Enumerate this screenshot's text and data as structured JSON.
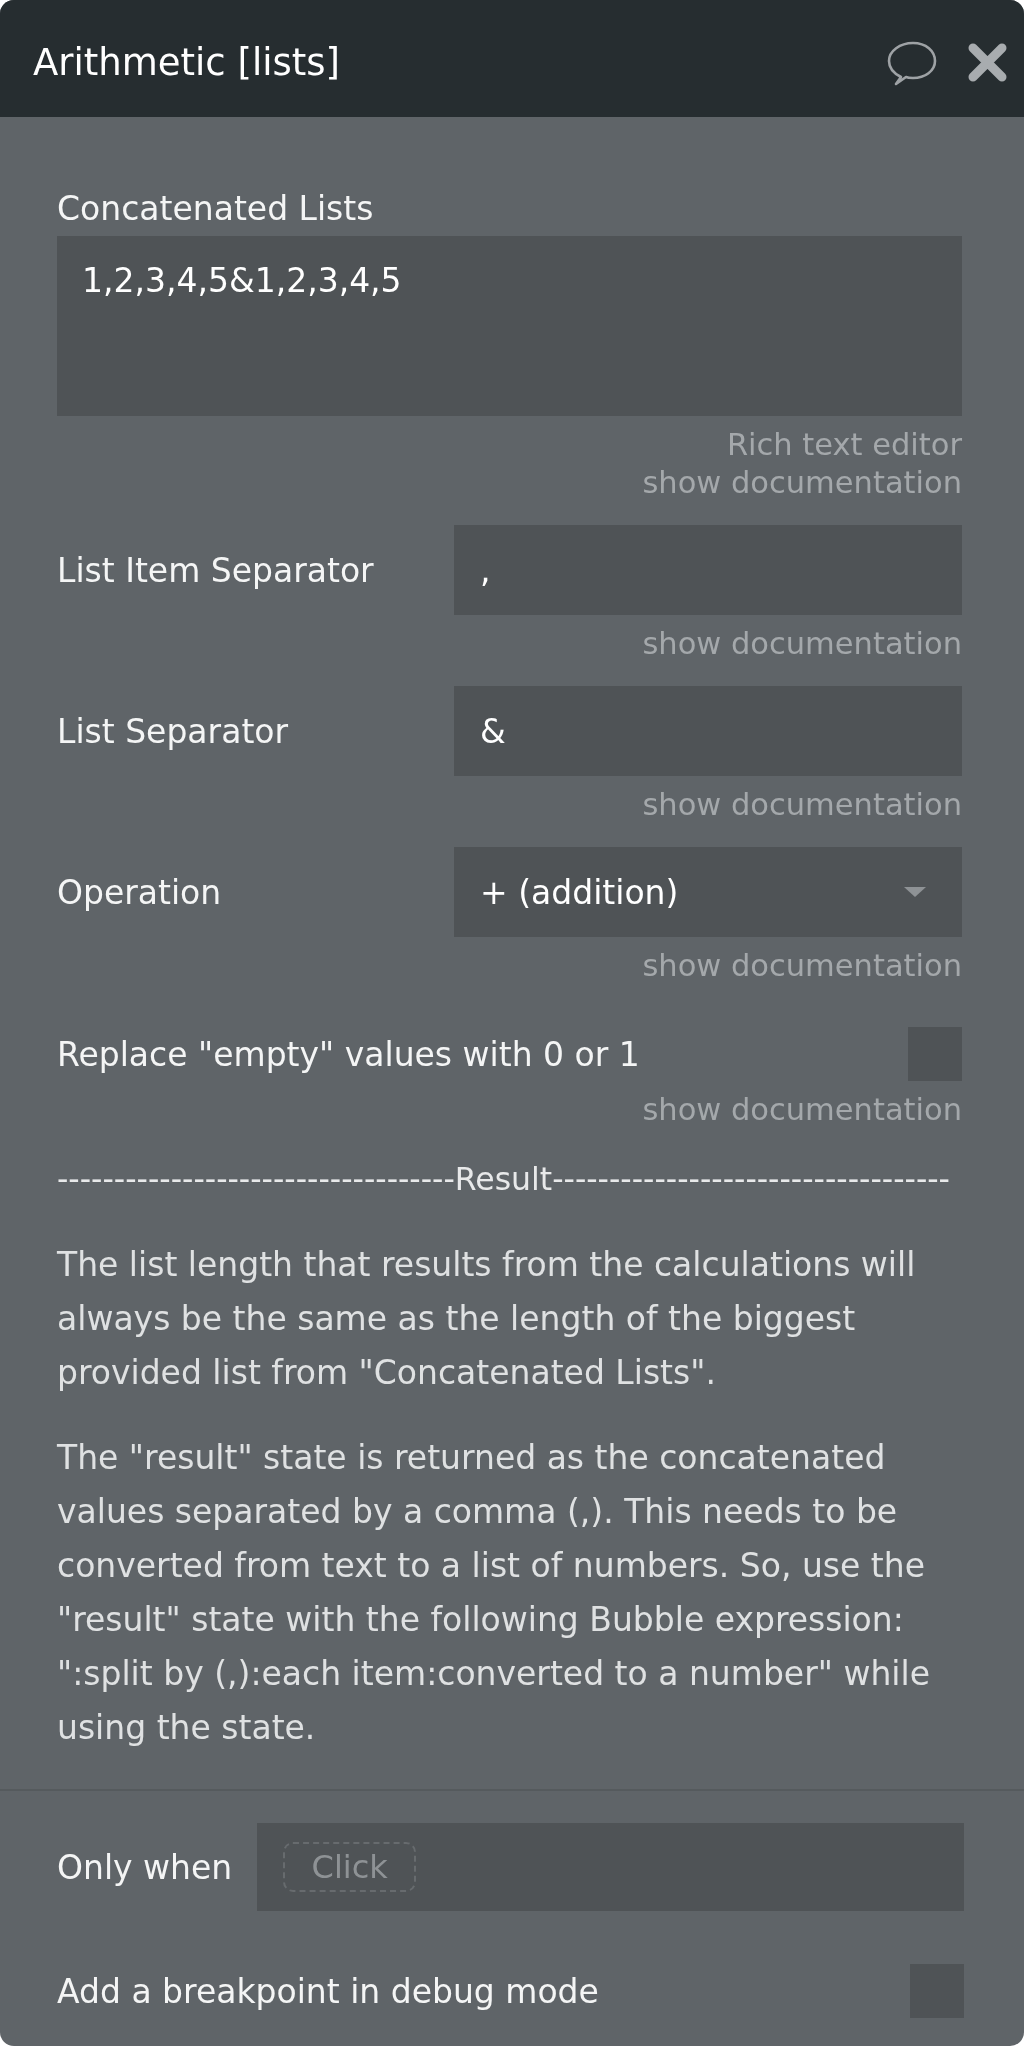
{
  "window": {
    "title": "Arithmetic [lists]"
  },
  "fields": [
    {
      "kind": "textarea",
      "label": "Concatenated Lists",
      "value": "1,2,3,4,5&1,2,3,4,5",
      "editor_link": "Rich text editor",
      "doc_link": "show documentation"
    },
    {
      "kind": "input",
      "label": "List Item Separator",
      "value": ",",
      "doc_link": "show documentation"
    },
    {
      "kind": "input",
      "label": "List Separator",
      "value": "&",
      "doc_link": "show documentation"
    },
    {
      "kind": "dropdown",
      "label": "Operation",
      "value": "+ (addition)",
      "doc_link": "show documentation"
    },
    {
      "kind": "checkbox",
      "label": "Replace \"empty\" values with 0 or 1",
      "checked": false,
      "doc_link": "show documentation"
    }
  ],
  "result": {
    "heading": "-----------------------------------Result-----------------------------------",
    "paragraphs": [
      "The list length that results from the calculations will always be the same as the length of the biggest provided list from \"Concatenated Lists\".",
      "The \"result\" state is returned as the concatenated values separated by a comma (,). This needs to be converted from text to a list of numbers. So, use the \"result\" state with the following Bubble expression: \":split by (,):each item:converted to a number\" while using the state."
    ]
  },
  "conditions": [
    {
      "kind": "expression",
      "label": "Only when",
      "button": "Click"
    },
    {
      "kind": "checkbox",
      "label": "Add a breakpoint in debug mode",
      "checked": false
    }
  ]
}
